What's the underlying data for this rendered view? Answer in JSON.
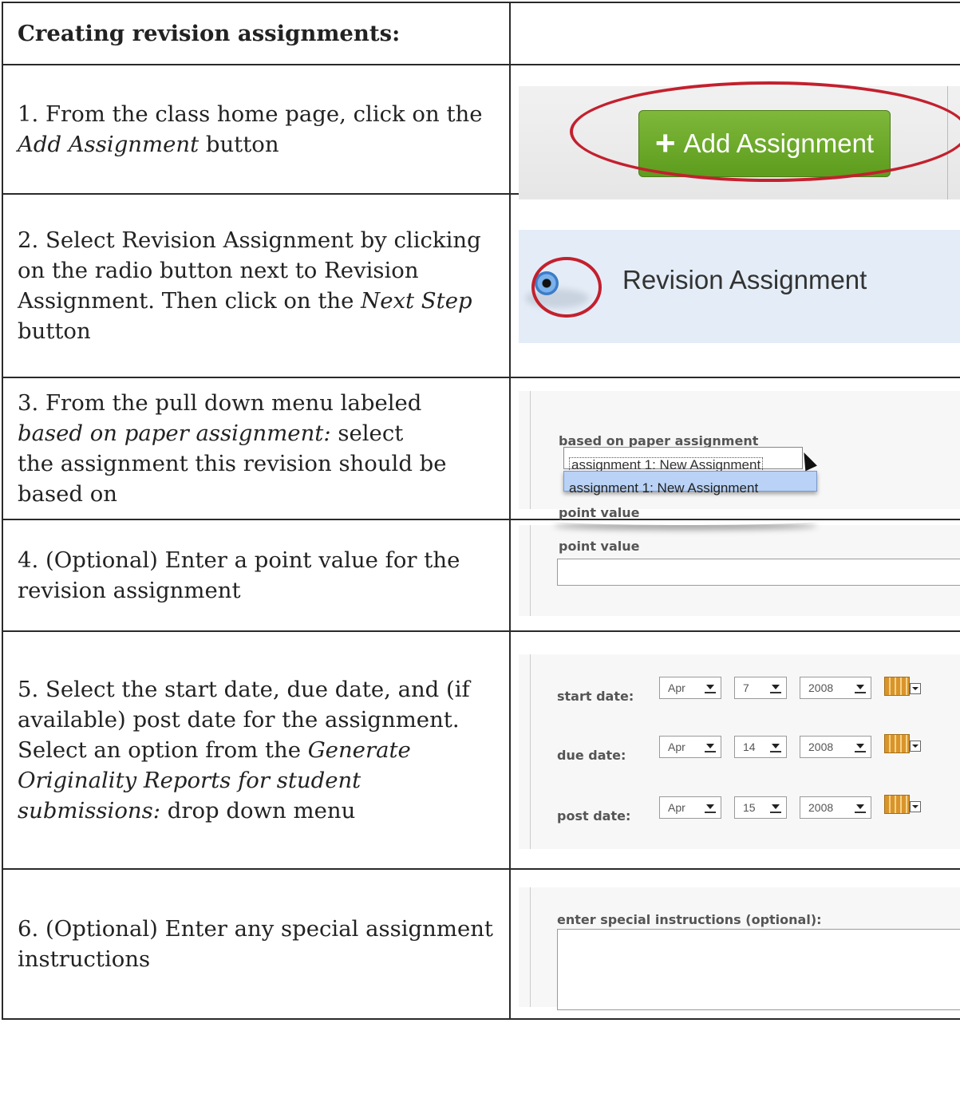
{
  "header": {
    "title": "Creating revision assignments:"
  },
  "steps": [
    {
      "lines": [
        {
          "parts": [
            "1. From the class home page, click on the"
          ]
        },
        {
          "parts": [
            "",
            "Add Assignment",
            " button"
          ]
        }
      ]
    },
    {
      "lines": [
        {
          "parts": [
            "2. Select Revision Assignment by clicking"
          ]
        },
        {
          "parts": [
            "on the radio button next to Revision"
          ]
        },
        {
          "parts": [
            "Assignment. Then click on the ",
            "Next Step"
          ]
        },
        {
          "parts": [
            "button"
          ]
        }
      ]
    },
    {
      "lines": [
        {
          "parts": [
            "3. From the pull down menu labeled"
          ]
        },
        {
          "parts": [
            "",
            "based on paper assignment:",
            " select"
          ]
        },
        {
          "parts": [
            "the assignment this revision should be"
          ]
        },
        {
          "parts": [
            "based on"
          ]
        }
      ]
    },
    {
      "lines": [
        {
          "parts": [
            "4. (Optional) Enter a point value for the"
          ]
        },
        {
          "parts": [
            "revision assignment"
          ]
        }
      ]
    },
    {
      "lines": [
        {
          "parts": [
            "5. Select the start date, due date, and (if"
          ]
        },
        {
          "parts": [
            "available) post date for the assignment."
          ]
        },
        {
          "parts": [
            "Select an option from the ",
            "Generate"
          ]
        },
        {
          "parts": [
            "",
            "Originality Reports for student"
          ]
        },
        {
          "parts": [
            "",
            "submissions:",
            " drop down menu"
          ]
        }
      ]
    },
    {
      "lines": [
        {
          "parts": [
            "6. (Optional) Enter any special assignment"
          ]
        },
        {
          "parts": [
            "instructions"
          ]
        }
      ]
    }
  ],
  "shots": {
    "add_button_label": "Add Assignment",
    "add_button_plus": "+",
    "revision_label": "Revision Assignment",
    "based_on_label": "based on paper assignment",
    "based_on_value": "assignment 1: New Assignment",
    "based_on_option": "assignment 1: New Assignment",
    "point_value_label": "point value",
    "point_value_label_2": "point value",
    "dates": [
      {
        "label": "start date:",
        "month": "Apr",
        "day": "7",
        "year": "2008"
      },
      {
        "label": "due date:",
        "month": "Apr",
        "day": "14",
        "year": "2008"
      },
      {
        "label": "post date:",
        "month": "Apr",
        "day": "15",
        "year": "2008"
      }
    ],
    "instructions_label": "enter special instructions (optional):"
  },
  "colors": {
    "highlight_ring": "#c3202e",
    "button_green": "#6aa829",
    "border": "#2a2a2a"
  }
}
